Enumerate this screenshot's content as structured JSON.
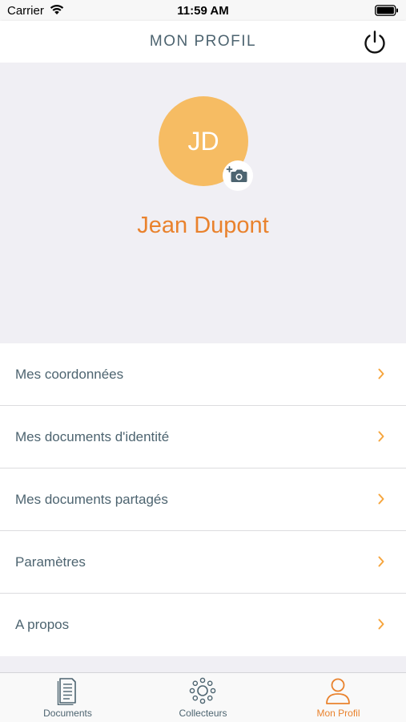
{
  "status_bar": {
    "carrier": "Carrier",
    "time": "11:59 AM"
  },
  "header": {
    "title": "MON PROFIL",
    "power_icon": "power-icon"
  },
  "profile": {
    "initials": "JD",
    "name": "Jean Dupont",
    "avatar_color": "#f6bc63",
    "add_photo_icon": "camera-plus-icon"
  },
  "menu": [
    {
      "label": "Mes coordonnées"
    },
    {
      "label": "Mes documents d'identité"
    },
    {
      "label": "Mes documents partagés"
    },
    {
      "label": "Paramètres"
    },
    {
      "label": "A propos"
    }
  ],
  "tabs": [
    {
      "label": "Documents",
      "icon": "document-icon",
      "active": false
    },
    {
      "label": "Collecteurs",
      "icon": "collectors-icon",
      "active": false
    },
    {
      "label": "Mon Profil",
      "icon": "user-icon",
      "active": true
    }
  ],
  "colors": {
    "accent": "#e9822d",
    "text": "#4d6470",
    "background": "#f0eff4"
  }
}
